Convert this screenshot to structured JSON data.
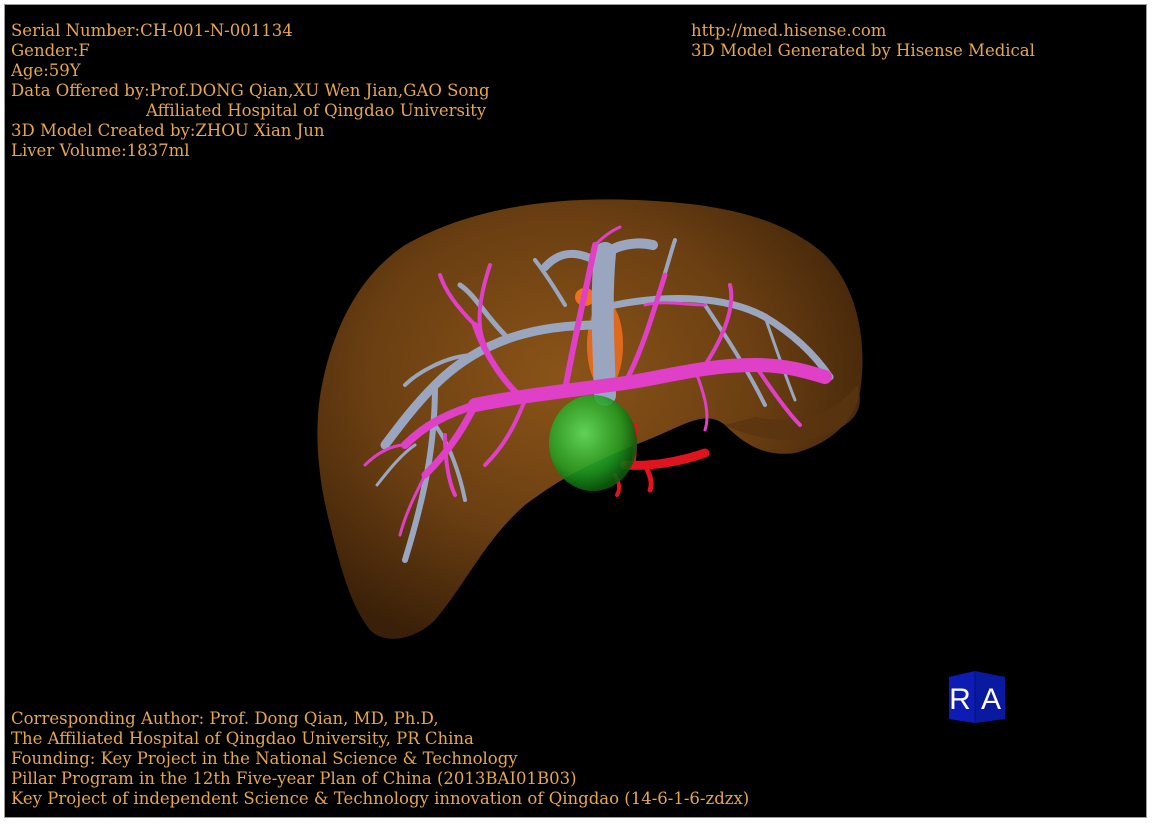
{
  "header_info": {
    "serial": "Serial Number:CH-001-N-001134",
    "gender": "Gender:F",
    "age": "Age:59Y",
    "data_offered": "Data Offered by:Prof.DONG Qian,XU Wen Jian,GAO Song",
    "hospital": "Affiliated Hospital of Qingdao University",
    "model_created": "3D Model Created by:ZHOU Xian Jun",
    "liver_volume": "Liver Volume:1837ml"
  },
  "web_info": {
    "url": "http://med.hisense.com",
    "generated_by": "3D Model Generated by Hisense Medical"
  },
  "footer": {
    "line1": "Corresponding Author: Prof. Dong Qian, MD, Ph.D,",
    "line2": "The Affiliated Hospital of Qingdao University, PR China",
    "line3": "Founding: Key Project in the National Science & Technology",
    "line4": "Pillar Program in the 12th Five-year Plan of China (2013BAI01B03)",
    "line5": "Key Project of independent Science & Technology innovation of Qingdao (14-6-1-6-zdzx)"
  },
  "orientation": {
    "left_label": "R",
    "right_label": "A"
  },
  "colors": {
    "text": "#e6a64e",
    "liver": "#6b3f12",
    "portal_vein": "#e040c8",
    "hepatic_vein": "#9aa6c0",
    "artery": "#e0141e",
    "tumor": "#28c028",
    "gallbladder": "#f07020",
    "cube": "#0a1aa0"
  }
}
